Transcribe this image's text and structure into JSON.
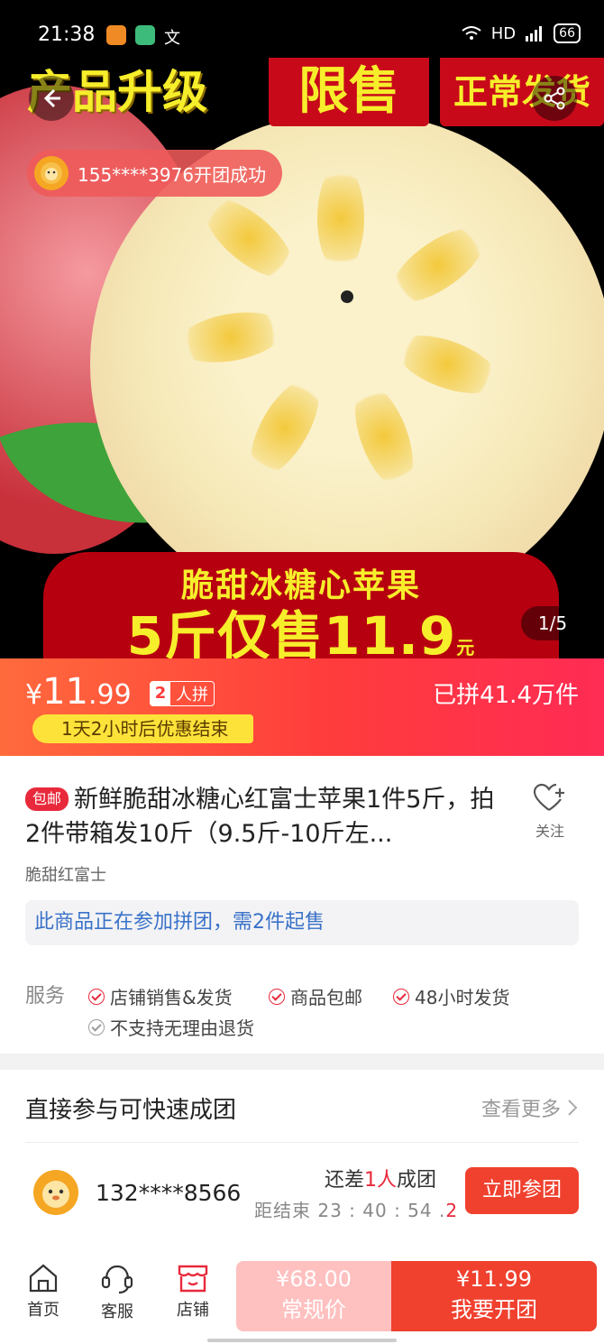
{
  "status_bar": {
    "time": "21:38",
    "network": "HD",
    "signal": "4G",
    "battery": "66"
  },
  "hero": {
    "banner_upgrade": "产品升级",
    "banner_limited": "限售",
    "banner_shipping": "正常发货",
    "toast_text": "155****3976开团成功",
    "promo_line1": "脆甜冰糖心苹果",
    "promo_line2": "5斤仅售11.9",
    "promo_unit": "元",
    "pager": "1/5"
  },
  "price_bar": {
    "currency": "¥",
    "price_int": "11",
    "price_dec": ".99",
    "group_size": "2",
    "group_label": "人拼",
    "joined_count": "已拼41.4万件",
    "countdown": "1天2小时后优惠结束"
  },
  "product": {
    "free_shipping_badge": "包邮",
    "title": "新鲜脆甜冰糖心红富士苹果1件5斤，拍2件带箱发10斤（9.5斤-10斤左...",
    "follow_label": "关注",
    "subtitle": "脆甜红富士",
    "group_notice": "此商品正在参加拼团，需2件起售",
    "services_label": "服务",
    "services": [
      {
        "label": "店铺销售&发货"
      },
      {
        "label": "商品包邮"
      },
      {
        "label": "48小时发货"
      },
      {
        "label": "不支持无理由退货"
      }
    ]
  },
  "quick_group": {
    "title": "直接参与可快速成团",
    "more_label": "查看更多",
    "user": "132****8566",
    "short_prefix": "还差",
    "short_count": "1人",
    "short_suffix": "成团",
    "timer_prefix": "距结束",
    "timer": "23 : 40 : 54 .",
    "timer_ms": "2",
    "join_label": "立即参团"
  },
  "bottom_bar": {
    "tabs": [
      {
        "label": "首页",
        "icon": "home-icon"
      },
      {
        "label": "客服",
        "icon": "customer-service-icon"
      },
      {
        "label": "店铺",
        "icon": "store-icon"
      }
    ],
    "regular_price": "¥68.00",
    "regular_label": "常规价",
    "open_price": "¥11.99",
    "open_label": "我要开团"
  },
  "colors": {
    "accent": "#f0412f",
    "price_gradient_start": "#ff6a3c",
    "link_blue": "#3a72c9",
    "promo_yellow": "#f7ee2b"
  }
}
